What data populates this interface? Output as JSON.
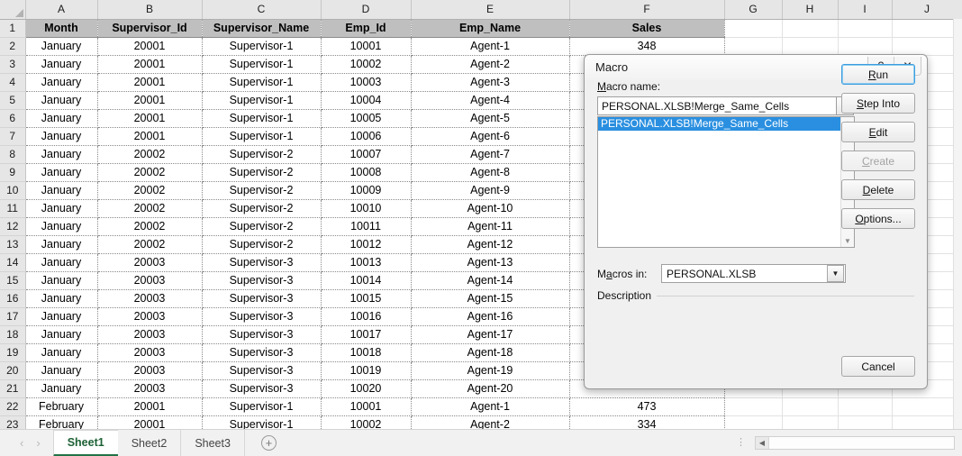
{
  "spreadsheet": {
    "columns": [
      "A",
      "B",
      "C",
      "D",
      "E",
      "F",
      "G",
      "H",
      "I",
      "J"
    ],
    "headers": [
      "Month",
      "Supervisor_Id",
      "Supervisor_Name",
      "Emp_Id",
      "Emp_Name",
      "Sales"
    ],
    "rows": [
      {
        "n": "2",
        "cells": [
          "January",
          "20001",
          "Supervisor-1",
          "10001",
          "Agent-1",
          "348"
        ]
      },
      {
        "n": "3",
        "cells": [
          "January",
          "20001",
          "Supervisor-1",
          "10002",
          "Agent-2",
          ""
        ]
      },
      {
        "n": "4",
        "cells": [
          "January",
          "20001",
          "Supervisor-1",
          "10003",
          "Agent-3",
          ""
        ]
      },
      {
        "n": "5",
        "cells": [
          "January",
          "20001",
          "Supervisor-1",
          "10004",
          "Agent-4",
          ""
        ]
      },
      {
        "n": "6",
        "cells": [
          "January",
          "20001",
          "Supervisor-1",
          "10005",
          "Agent-5",
          ""
        ]
      },
      {
        "n": "7",
        "cells": [
          "January",
          "20001",
          "Supervisor-1",
          "10006",
          "Agent-6",
          ""
        ]
      },
      {
        "n": "8",
        "cells": [
          "January",
          "20002",
          "Supervisor-2",
          "10007",
          "Agent-7",
          ""
        ]
      },
      {
        "n": "9",
        "cells": [
          "January",
          "20002",
          "Supervisor-2",
          "10008",
          "Agent-8",
          ""
        ]
      },
      {
        "n": "10",
        "cells": [
          "January",
          "20002",
          "Supervisor-2",
          "10009",
          "Agent-9",
          ""
        ]
      },
      {
        "n": "11",
        "cells": [
          "January",
          "20002",
          "Supervisor-2",
          "10010",
          "Agent-10",
          ""
        ]
      },
      {
        "n": "12",
        "cells": [
          "January",
          "20002",
          "Supervisor-2",
          "10011",
          "Agent-11",
          ""
        ]
      },
      {
        "n": "13",
        "cells": [
          "January",
          "20002",
          "Supervisor-2",
          "10012",
          "Agent-12",
          ""
        ]
      },
      {
        "n": "14",
        "cells": [
          "January",
          "20003",
          "Supervisor-3",
          "10013",
          "Agent-13",
          ""
        ]
      },
      {
        "n": "15",
        "cells": [
          "January",
          "20003",
          "Supervisor-3",
          "10014",
          "Agent-14",
          ""
        ]
      },
      {
        "n": "16",
        "cells": [
          "January",
          "20003",
          "Supervisor-3",
          "10015",
          "Agent-15",
          ""
        ]
      },
      {
        "n": "17",
        "cells": [
          "January",
          "20003",
          "Supervisor-3",
          "10016",
          "Agent-16",
          ""
        ]
      },
      {
        "n": "18",
        "cells": [
          "January",
          "20003",
          "Supervisor-3",
          "10017",
          "Agent-17",
          ""
        ]
      },
      {
        "n": "19",
        "cells": [
          "January",
          "20003",
          "Supervisor-3",
          "10018",
          "Agent-18",
          ""
        ]
      },
      {
        "n": "20",
        "cells": [
          "January",
          "20003",
          "Supervisor-3",
          "10019",
          "Agent-19",
          ""
        ]
      },
      {
        "n": "21",
        "cells": [
          "January",
          "20003",
          "Supervisor-3",
          "10020",
          "Agent-20",
          ""
        ]
      },
      {
        "n": "22",
        "cells": [
          "February",
          "20001",
          "Supervisor-1",
          "10001",
          "Agent-1",
          "473"
        ]
      },
      {
        "n": "23",
        "cells": [
          "February",
          "20001",
          "Supervisor-1",
          "10002",
          "Agent-2",
          "334"
        ]
      }
    ]
  },
  "sheet_tabs": {
    "prev_icon": "‹",
    "next_icon": "›",
    "tabs": [
      {
        "label": "Sheet1",
        "active": true
      },
      {
        "label": "Sheet2",
        "active": false
      },
      {
        "label": "Sheet3",
        "active": false
      }
    ],
    "add_label": "+",
    "scroll_left_icon": "◀"
  },
  "dialog": {
    "title": "Macro",
    "help_icon": "?",
    "close_icon": "✕",
    "macro_name_label": "Macro name:",
    "macro_name_value": "PERSONAL.XLSB!Merge_Same_Cells",
    "up_icon": "⬆",
    "list_items": [
      {
        "label": "PERSONAL.XLSB!Merge_Same_Cells",
        "selected": true
      }
    ],
    "scroll_up_icon": "▲",
    "scroll_down_icon": "▼",
    "macros_in_label": "Macros in:",
    "macros_in_value": "PERSONAL.XLSB",
    "combo_arrow_icon": "▼",
    "description_label": "Description",
    "buttons": [
      {
        "label": "Run",
        "state": "focused"
      },
      {
        "label": "Step Into",
        "state": "normal"
      },
      {
        "label": "Edit",
        "state": "normal"
      },
      {
        "label": "Create",
        "state": "disabled"
      },
      {
        "label": "Delete",
        "state": "normal"
      },
      {
        "label": "Options...",
        "state": "normal"
      }
    ],
    "cancel_label": "Cancel",
    "accent_color": "#3c9de0",
    "selection_color": "#2a8fe0"
  }
}
